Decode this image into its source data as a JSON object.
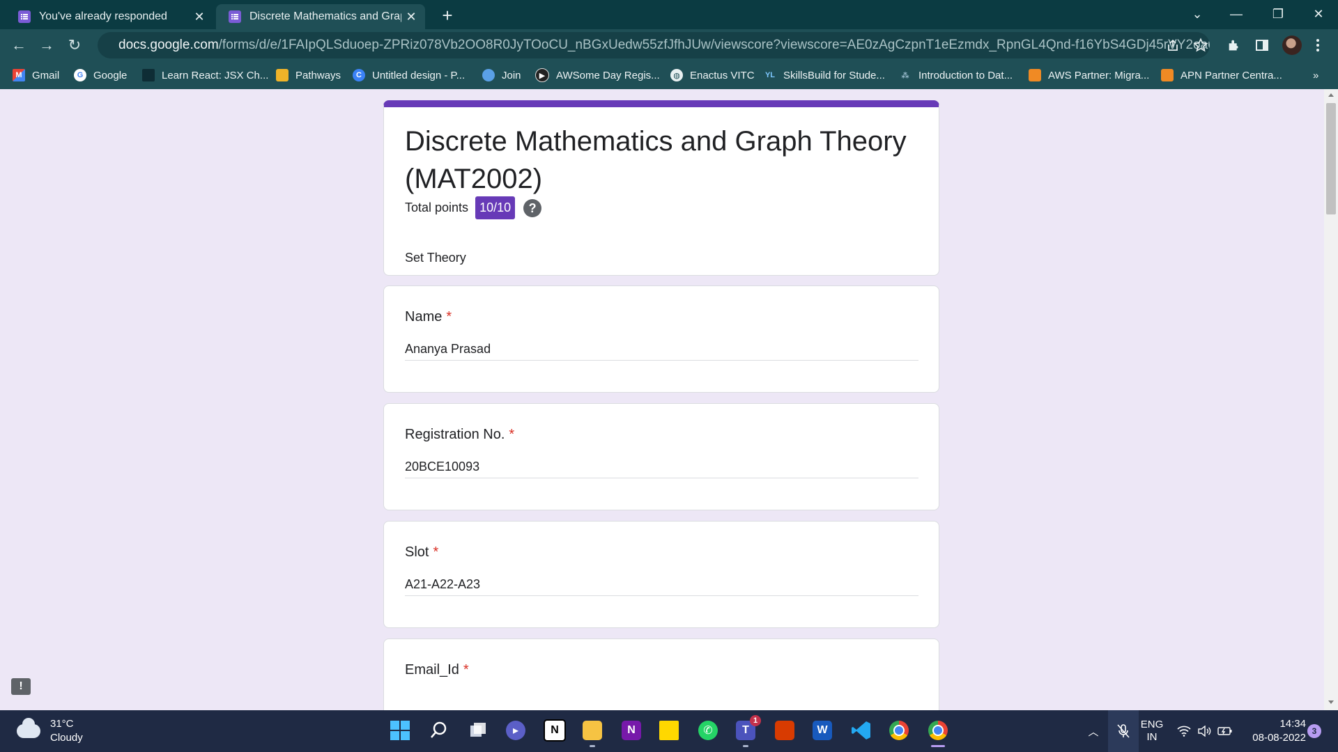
{
  "browser": {
    "tabs": [
      {
        "title": "You've already responded",
        "active": false
      },
      {
        "title": "Discrete Mathematics and Graph",
        "active": true
      }
    ],
    "url_host": "docs.google.com",
    "url_path": "/forms/d/e/1FAIpQLSduoep-ZPRiz078Vb2OO8R0JyTOoCU_nBGxUedw55zfJfhJUw/viewscore?viewscore=AE0zAgCzpnT1eEzmdx_RpnGL4Qnd-f16YbS4GDj45rVY2oa6vzBwZjCr...",
    "bookmarks": [
      {
        "label": "Gmail"
      },
      {
        "label": "Google"
      },
      {
        "label": "Learn React: JSX Ch..."
      },
      {
        "label": "Pathways"
      },
      {
        "label": "Untitled design - P..."
      },
      {
        "label": "Join"
      },
      {
        "label": "AWSome Day Regis..."
      },
      {
        "label": "Enactus VITC"
      },
      {
        "label": "SkillsBuild for Stude..."
      },
      {
        "label": "Introduction to Dat..."
      },
      {
        "label": "AWS Partner: Migra..."
      },
      {
        "label": "APN Partner Centra..."
      }
    ],
    "bookmarks_overflow": "»"
  },
  "form": {
    "title": "Discrete Mathematics and Graph Theory (MAT2002)",
    "total_points_label": "Total points",
    "total_points": "10/10",
    "description": "Set Theory",
    "required_mark": "*",
    "questions": [
      {
        "label": "Name",
        "answer": "Ananya Prasad"
      },
      {
        "label": "Registration No.",
        "answer": "20BCE10093"
      },
      {
        "label": "Slot",
        "answer": "A21-A22-A23"
      },
      {
        "label": "Email_Id",
        "answer": ""
      }
    ],
    "accent_color": "#673ab7"
  },
  "taskbar": {
    "weather_temp": "31°C",
    "weather_desc": "Cloudy",
    "language_top": "ENG",
    "language_bottom": "IN",
    "time": "14:34",
    "date": "08-08-2022",
    "notification_count": "3",
    "teams_badge": "1"
  }
}
